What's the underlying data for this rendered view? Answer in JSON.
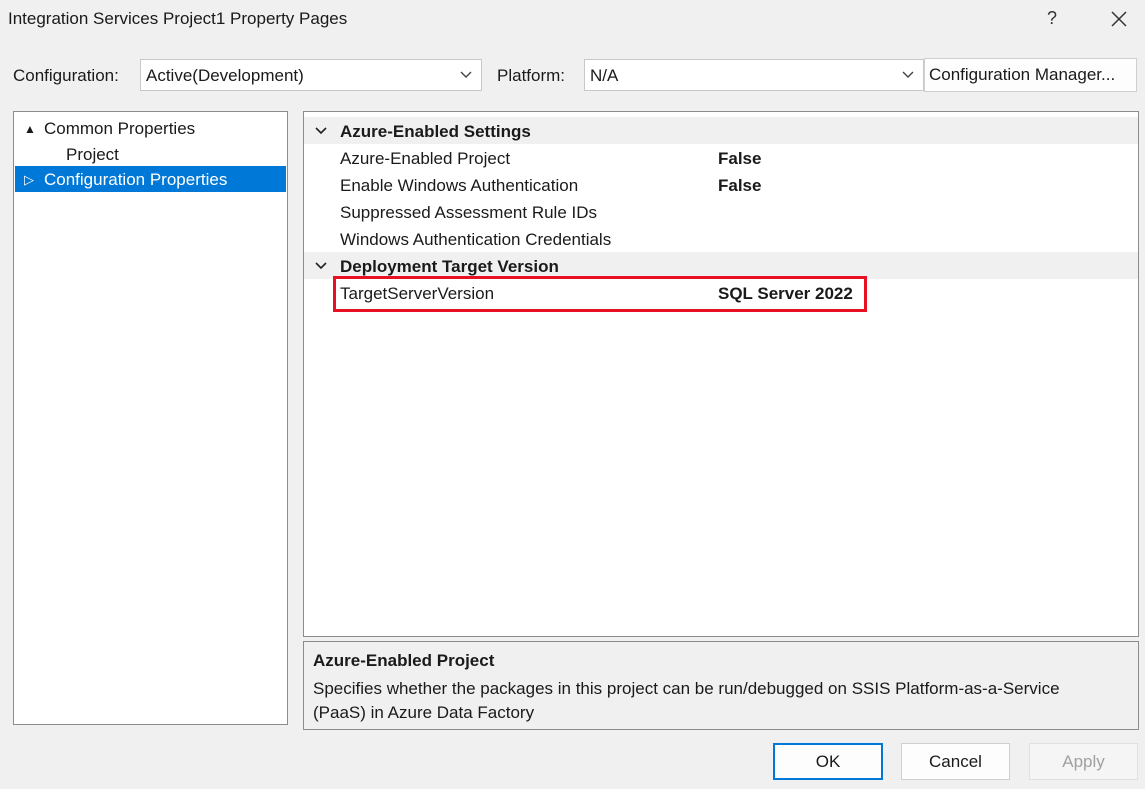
{
  "window": {
    "title": "Integration Services Project1 Property Pages",
    "help_glyph": "?"
  },
  "toolbar": {
    "configuration_label": "Configuration:",
    "configuration_value": "Active(Development)",
    "platform_label": "Platform:",
    "platform_value": "N/A",
    "config_manager_label": "Configuration Manager..."
  },
  "tree": {
    "items": [
      {
        "label": "Common Properties",
        "expander": "▲"
      },
      {
        "label": "Project"
      },
      {
        "label": "Configuration Properties",
        "expander": "▷"
      }
    ]
  },
  "properties": {
    "categories": [
      {
        "label": "Azure-Enabled Settings",
        "rows": [
          {
            "name": "Azure-Enabled Project",
            "value": "False"
          },
          {
            "name": "Enable Windows Authentication",
            "value": "False"
          },
          {
            "name": "Suppressed Assessment Rule IDs",
            "value": ""
          },
          {
            "name": "Windows Authentication Credentials",
            "value": ""
          }
        ]
      },
      {
        "label": "Deployment Target Version",
        "rows": [
          {
            "name": "TargetServerVersion",
            "value": "SQL Server 2022"
          }
        ]
      }
    ]
  },
  "description": {
    "title": "Azure-Enabled Project",
    "text": "Specifies whether the packages in this project can be run/debugged on SSIS Platform-as-a-Service (PaaS) in Azure Data Factory"
  },
  "buttons": {
    "ok": "OK",
    "cancel": "Cancel",
    "apply": "Apply"
  },
  "colors": {
    "selection": "#0078d7",
    "highlight_border": "#e81123"
  }
}
